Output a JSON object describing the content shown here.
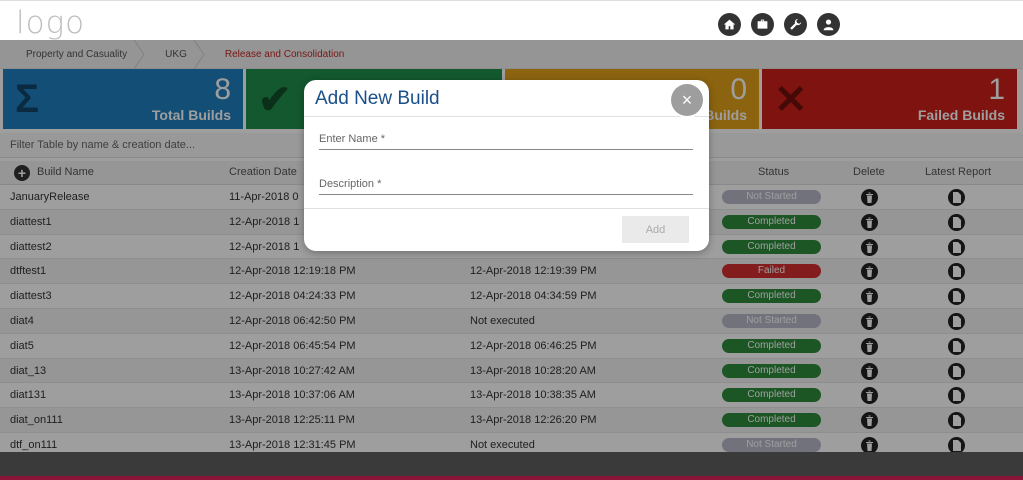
{
  "header": {
    "logo_text": "logo",
    "icons": [
      "home-icon",
      "briefcase-icon",
      "wrench-icon",
      "user-icon"
    ]
  },
  "breadcrumb": {
    "items": [
      "Property and Casuality",
      "UKG",
      "Release and Consolidation"
    ]
  },
  "tiles": [
    {
      "value": "8",
      "label": "Total Builds",
      "color": "#1f7fbf",
      "icon": "sigma-icon"
    },
    {
      "value": "",
      "label": "",
      "color": "#1f8f4c",
      "icon": "check-icon"
    },
    {
      "value": "0",
      "label": "Builds",
      "color": "#e3a21a",
      "icon": ""
    },
    {
      "value": "1",
      "label": "Failed Builds",
      "color": "#cc1f1a",
      "icon": "x-icon"
    }
  ],
  "filter": {
    "placeholder": "Filter Table by name & creation date..."
  },
  "table": {
    "headers": {
      "build_name": "Build Name",
      "creation_date": "Creation Date",
      "status": "Status",
      "delete": "Delete",
      "latest_report": "Latest Report"
    },
    "rows": [
      {
        "name": "JanuaryRelease",
        "created": "11-Apr-2018 0",
        "executed": "",
        "status": "Not Started"
      },
      {
        "name": "diattest1",
        "created": "12-Apr-2018 1",
        "executed": "",
        "status": "Completed"
      },
      {
        "name": "diattest2",
        "created": "12-Apr-2018 1",
        "executed": "",
        "status": "Completed"
      },
      {
        "name": "dtftest1",
        "created": "12-Apr-2018 12:19:18 PM",
        "executed": "12-Apr-2018 12:19:39 PM",
        "status": "Failed"
      },
      {
        "name": "diattest3",
        "created": "12-Apr-2018 04:24:33 PM",
        "executed": "12-Apr-2018 04:34:59 PM",
        "status": "Completed"
      },
      {
        "name": "diat4",
        "created": "12-Apr-2018 06:42:50 PM",
        "executed": "Not executed",
        "status": "Not Started"
      },
      {
        "name": "diat5",
        "created": "12-Apr-2018 06:45:54 PM",
        "executed": "12-Apr-2018 06:46:25 PM",
        "status": "Completed"
      },
      {
        "name": "diat_13",
        "created": "13-Apr-2018 10:27:42 AM",
        "executed": "13-Apr-2018 10:28:20 AM",
        "status": "Completed"
      },
      {
        "name": "diat131",
        "created": "13-Apr-2018 10:37:06 AM",
        "executed": "13-Apr-2018 10:38:35 AM",
        "status": "Completed"
      },
      {
        "name": "diat_on111",
        "created": "13-Apr-2018 12:25:11 PM",
        "executed": "13-Apr-2018 12:26:20 PM",
        "status": "Completed"
      },
      {
        "name": "dtf_on111",
        "created": "13-Apr-2018 12:31:45 PM",
        "executed": "Not executed",
        "status": "Not Started"
      }
    ]
  },
  "modal": {
    "title": "Add New Build",
    "close_label": "×",
    "name_placeholder": "Enter Name *",
    "description_placeholder": "Description *",
    "add_label": "Add"
  }
}
